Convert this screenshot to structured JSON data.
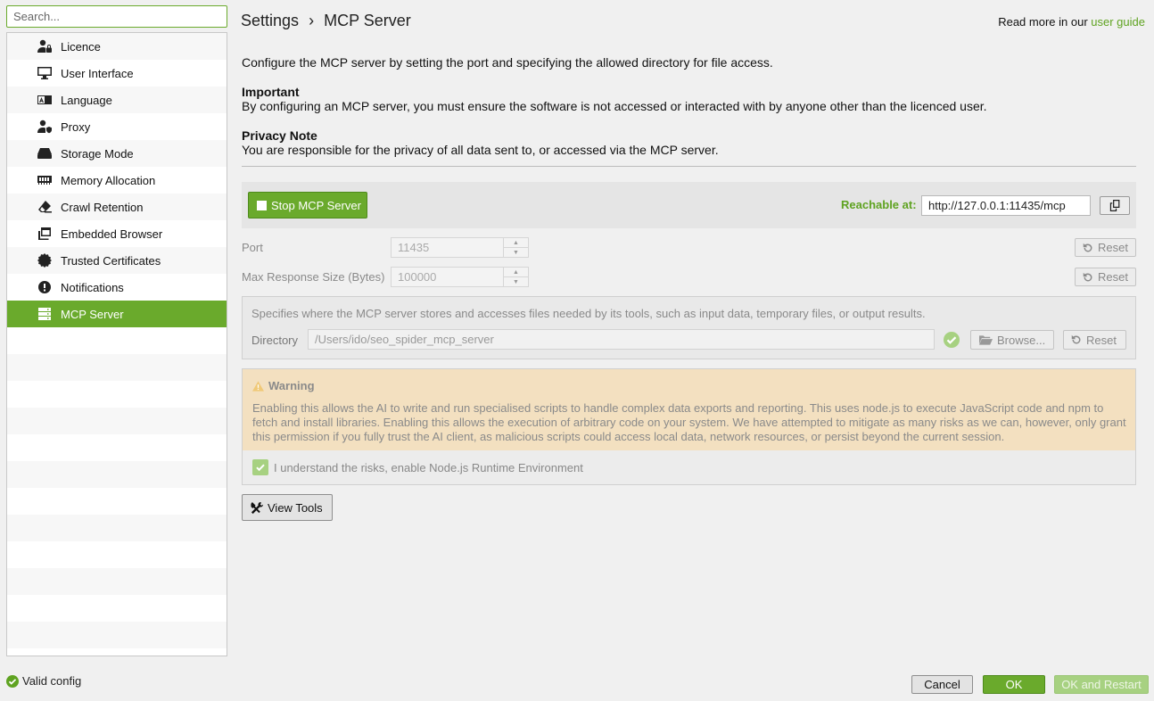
{
  "search": {
    "placeholder": "Search..."
  },
  "sidebar": {
    "items": [
      {
        "label": "Licence",
        "icon": "user-lock-icon"
      },
      {
        "label": "User Interface",
        "icon": "monitor-icon"
      },
      {
        "label": "Language",
        "icon": "language-icon"
      },
      {
        "label": "Proxy",
        "icon": "user-shield-icon"
      },
      {
        "label": "Storage Mode",
        "icon": "hard-drive-icon"
      },
      {
        "label": "Memory Allocation",
        "icon": "memory-icon"
      },
      {
        "label": "Crawl Retention",
        "icon": "eraser-icon"
      },
      {
        "label": "Embedded Browser",
        "icon": "browser-windows-icon"
      },
      {
        "label": "Trusted Certificates",
        "icon": "certificate-icon"
      },
      {
        "label": "Notifications",
        "icon": "exclamation-circle-icon"
      },
      {
        "label": "MCP Server",
        "icon": "server-icon",
        "selected": true
      }
    ]
  },
  "status": {
    "valid_config": "Valid config"
  },
  "header": {
    "title": "Settings",
    "separator": "›",
    "subtitle": "MCP Server",
    "read_more": "Read more in our",
    "user_guide": "user guide"
  },
  "content": {
    "description": "Configure the MCP server by setting the port and specifying the allowed directory for file access.",
    "important_title": "Important",
    "important_text": "By configuring an MCP server, you must ensure the software is not accessed or interacted with by anyone other than the licenced user.",
    "privacy_title": "Privacy Note",
    "privacy_text": "You are responsible for the privacy of all data sent to, or accessed via the MCP server."
  },
  "server": {
    "stop_label": "Stop MCP Server",
    "reachable_label": "Reachable at:",
    "url": "http://127.0.0.1:11435/mcp"
  },
  "fields": {
    "port_label": "Port",
    "port_value": "11435",
    "max_label": "Max Response Size (Bytes)",
    "max_value": "100000",
    "reset_label": "Reset"
  },
  "directory": {
    "description": "Specifies where the MCP server stores and accesses files needed by its tools, such as input data, temporary files, or output results.",
    "label": "Directory",
    "value": "/Users/ido/seo_spider_mcp_server",
    "browse_label": "Browse...",
    "reset_label": "Reset"
  },
  "warning": {
    "title": "Warning",
    "text": "Enabling this allows the AI to write and run specialised scripts to handle complex data exports and reporting. This uses node.js to execute JavaScript code and npm to fetch and install libraries. Enabling this allows the execution of arbitrary code on your system. We have attempted to mitigate as many risks as we can, however, only grant this permission if you fully trust the AI client, as malicious scripts could access local data, network resources, or persist beyond the current session.",
    "checkbox_label": "I understand the risks, enable Node.js Runtime Environment",
    "checked": true
  },
  "actions": {
    "view_tools": "View Tools",
    "cancel": "Cancel",
    "ok": "OK",
    "ok_restart": "OK and Restart"
  },
  "colors": {
    "accent": "#6aaa2c",
    "link": "#5fa321",
    "warning_bg": "#f3e0c0"
  }
}
